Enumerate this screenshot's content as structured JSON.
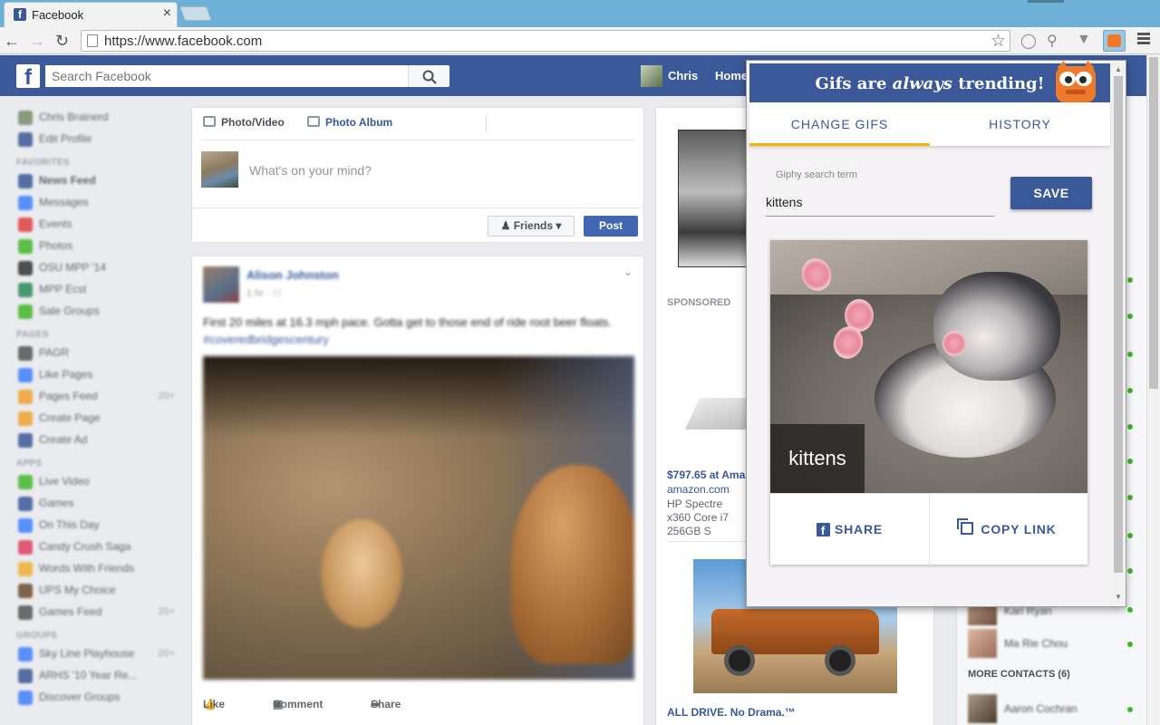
{
  "browser": {
    "tab_title": "Facebook",
    "tab_close": "×",
    "url": "https://www.facebook.com"
  },
  "fb": {
    "logo": "f",
    "search_placeholder": "Search Facebook",
    "user_name": "Chris",
    "home_label": "Home"
  },
  "sidebar": {
    "profile": [
      {
        "label": "Chris Brainerd",
        "color": "#7a8a6a"
      },
      {
        "label": "Edit Profile",
        "color": "#3b5998"
      }
    ],
    "favorites_heading": "FAVORITES",
    "favorites": [
      {
        "label": "News Feed",
        "color": "#3b5998"
      },
      {
        "label": "Messages",
        "color": "#4080ff"
      },
      {
        "label": "Events",
        "color": "#e04040"
      },
      {
        "label": "Photos",
        "color": "#42b72a"
      },
      {
        "label": "OSU MPP '14",
        "color": "#333"
      },
      {
        "label": "MPP Ecst",
        "color": "#2c8a5a"
      },
      {
        "label": "Sale Groups",
        "color": "#42b72a"
      }
    ],
    "pages_heading": "PAGES",
    "pages": [
      {
        "label": "PAGR",
        "color": "#555"
      },
      {
        "label": "Like Pages",
        "color": "#4080ff"
      },
      {
        "label": "Pages Feed",
        "color": "#f0a030",
        "count": "20+"
      },
      {
        "label": "Create Page",
        "color": "#f0a030"
      },
      {
        "label": "Create Ad",
        "color": "#3b5998"
      }
    ],
    "apps_heading": "APPS",
    "apps": [
      {
        "label": "Live Video",
        "color": "#42b72a"
      },
      {
        "label": "Games",
        "color": "#3b5998"
      },
      {
        "label": "On This Day",
        "color": "#4080ff"
      },
      {
        "label": "Candy Crush Saga",
        "color": "#e04060"
      },
      {
        "label": "Words With Friends",
        "color": "#f0b030"
      },
      {
        "label": "UPS My Choice",
        "color": "#6b4b2b"
      },
      {
        "label": "Games Feed",
        "color": "#555",
        "count": "20+"
      }
    ],
    "groups_heading": "GROUPS",
    "groups": [
      {
        "label": "Sky Line Playhouse",
        "color": "#4080ff",
        "count": "20+"
      },
      {
        "label": "ARHS '10 Year Re...",
        "color": "#3b5998"
      },
      {
        "label": "Discover Groups",
        "color": "#4080ff"
      }
    ]
  },
  "composer": {
    "tab_photo": "Photo/Video",
    "tab_album": "Photo Album",
    "placeholder": "What's on your mind?",
    "audience": "Friends",
    "post_button": "Post"
  },
  "post": {
    "author": "Alison Johnston",
    "time": "1 hr · ⚇",
    "text": "First 20 miles at 16.3 mph pace. Gotta get to those end of ride root beer floats.",
    "hashtag": "#coveredbridgescentury",
    "like": "Like",
    "comment": "Comment",
    "share": "Share"
  },
  "right": {
    "sponsored": "SPONSORED",
    "ad1_price": "$797.65 at Ama",
    "ad1_site": "amazon.com",
    "ad1_desc": "HP Spectre x360 Core i7 256GB S",
    "ad2_title": "ALL DRIVE. No Drama.™"
  },
  "chat": {
    "contacts": [
      {
        "name": "Kari Ryan"
      },
      {
        "name": "Ma Rie Chou"
      }
    ],
    "more_contacts": "MORE CONTACTS (6)",
    "bottom_contact": "Aaron Cochran"
  },
  "popup": {
    "title_pre": "Gifs are ",
    "title_em": "always",
    "title_post": " trending!",
    "tab_change": "CHANGE GIFS",
    "tab_history": "HISTORY",
    "search_label": "Giphy search term",
    "search_value": "kittens",
    "save_button": "SAVE",
    "gif_caption": "kittens",
    "share_button": "SHARE",
    "copy_button": "COPY LINK",
    "colors": {
      "header": "#3b5998",
      "tab_indicator": "#f4b400",
      "mascot": "#f07a2b"
    }
  }
}
